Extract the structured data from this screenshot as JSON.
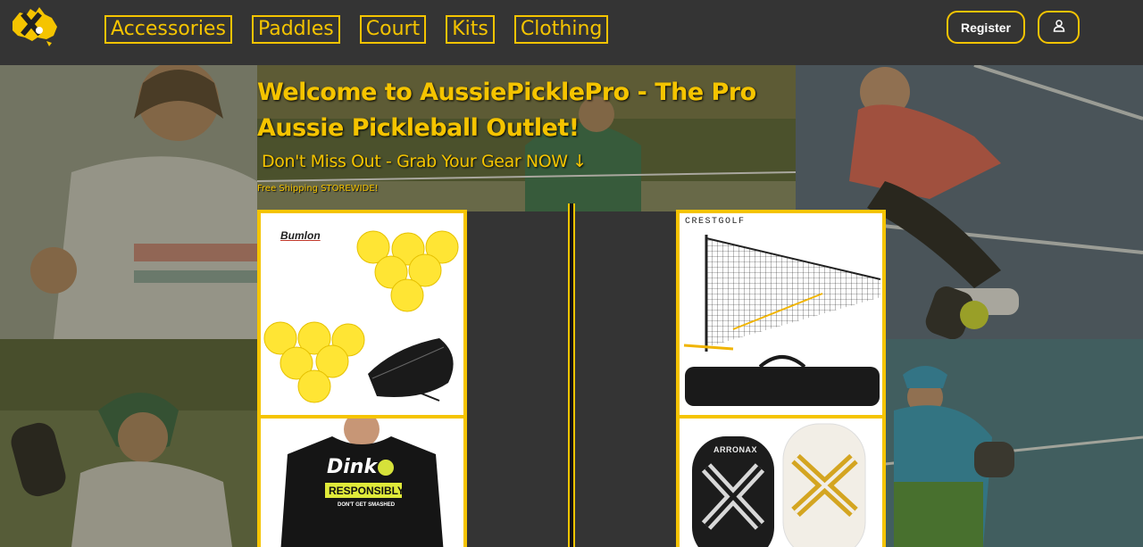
{
  "header": {
    "logo_icon": "australia-pickleball-logo",
    "nav": [
      {
        "label": "Accessories"
      },
      {
        "label": "Paddles"
      },
      {
        "label": "Court"
      },
      {
        "label": "Kits"
      },
      {
        "label": "Clothing"
      }
    ],
    "register_label": "Register",
    "account_icon": "user-icon"
  },
  "hero": {
    "title": "Welcome to AussiePicklePro - The Pro Aussie Pickleball Outlet!",
    "subtitle": "Don't Miss Out - Grab Your Gear NOW ↓",
    "shipping_note": "Free Shipping STOREWIDE!"
  },
  "products": {
    "balls": {
      "brand": "Bumlon"
    },
    "net": {
      "brand": "CRESTGOLF"
    },
    "shirt": {
      "line1": "Dink",
      "line2": "RESPONSIBLY",
      "line3": "DON'T GET SMASHED"
    },
    "paddles": {
      "brand": "ARRONAX"
    }
  },
  "colors": {
    "accent": "#f5c400",
    "header_bg": "#343434"
  }
}
